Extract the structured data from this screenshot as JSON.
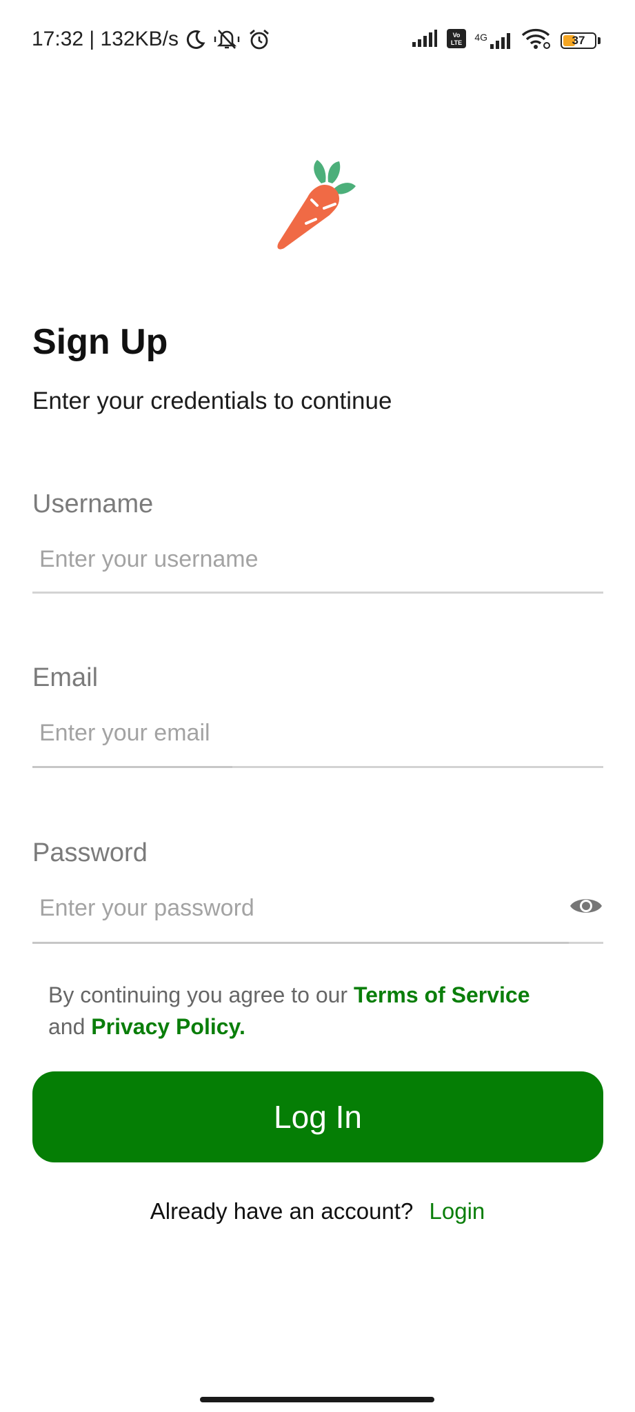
{
  "status_bar": {
    "time_speed": "17:32 | 132KB/s",
    "network_label": "4G",
    "volte_label": "Vo LTE",
    "battery_level": "37"
  },
  "app": {
    "logo_icon": "carrot-icon"
  },
  "header": {
    "title": "Sign Up",
    "subtitle": "Enter your credentials to continue"
  },
  "form": {
    "username": {
      "label": "Username",
      "placeholder": "Enter your username",
      "value": ""
    },
    "email": {
      "label": "Email",
      "placeholder": "Enter your email",
      "value": ""
    },
    "password": {
      "label": "Password",
      "placeholder": "Enter your password",
      "value": ""
    }
  },
  "terms": {
    "prefix": "By continuing you agree  to our ",
    "terms_link": "Terms of Service",
    "middle": "and ",
    "privacy_link": "Privacy Policy."
  },
  "login_button": {
    "label": "Log In"
  },
  "footer": {
    "prompt": "Already have an account?",
    "login_link": "Login"
  },
  "colors": {
    "primary": "#057e05",
    "link": "#0a7e0a",
    "carrot_body": "#f06a45",
    "carrot_leaves": "#4caf7a",
    "battery_fill": "#f5a623"
  }
}
